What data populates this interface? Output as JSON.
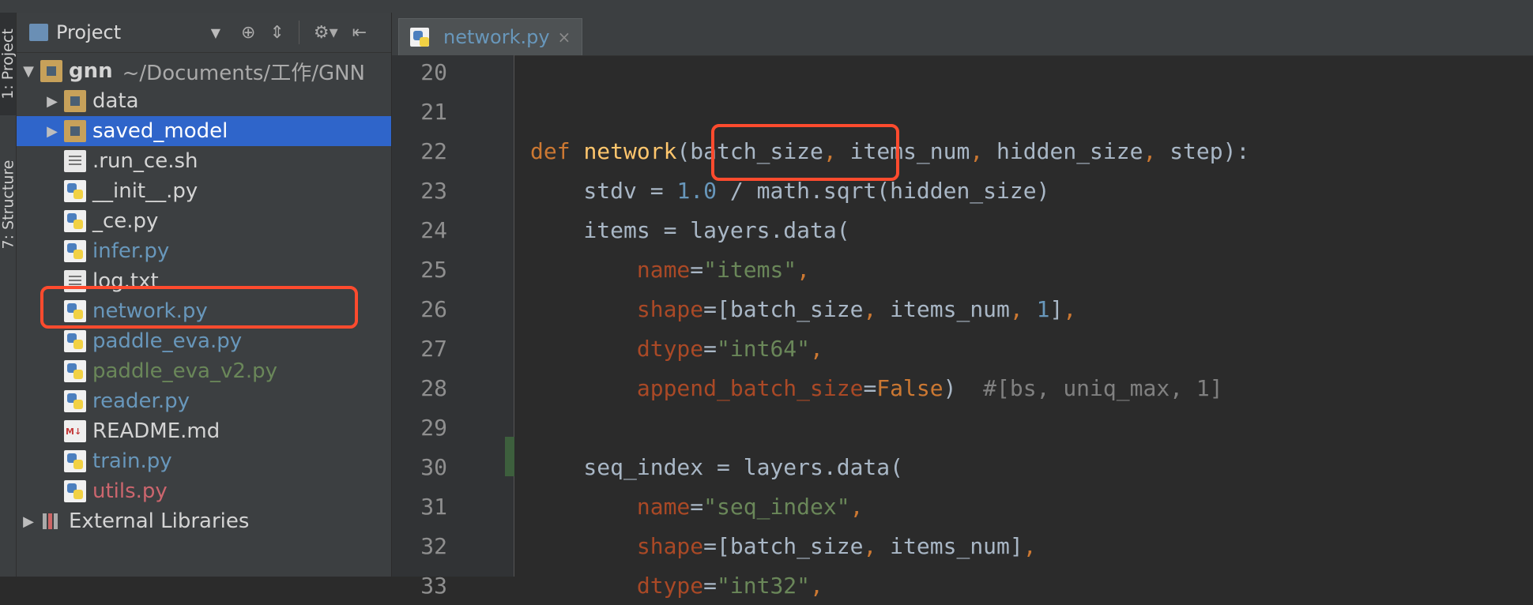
{
  "rail": {
    "project_tab": "1: Project",
    "structure_tab": "7: Structure"
  },
  "project": {
    "title": "Project",
    "tree": [
      {
        "name": "gnn",
        "path": "~/Documents/工作/GNN",
        "icon": "folder",
        "expanded": true,
        "indent": 0
      },
      {
        "name": "data",
        "icon": "folder",
        "collapsed": true,
        "indent": 1
      },
      {
        "name": "saved_model",
        "icon": "folder",
        "collapsed": true,
        "indent": 1,
        "selected": true
      },
      {
        "name": ".run_ce.sh",
        "icon": "txt",
        "indent": 1
      },
      {
        "name": "__init__.py",
        "icon": "py",
        "indent": 1
      },
      {
        "name": "_ce.py",
        "icon": "py",
        "indent": 1
      },
      {
        "name": "infer.py",
        "icon": "py",
        "indent": 1,
        "color": "blue"
      },
      {
        "name": "log.txt",
        "icon": "txt",
        "indent": 1
      },
      {
        "name": "network.py",
        "icon": "py",
        "indent": 1,
        "color": "blue"
      },
      {
        "name": "paddle_eva.py",
        "icon": "py",
        "indent": 1,
        "color": "blue"
      },
      {
        "name": "paddle_eva_v2.py",
        "icon": "py",
        "indent": 1,
        "color": "green"
      },
      {
        "name": "reader.py",
        "icon": "py",
        "indent": 1,
        "color": "blue"
      },
      {
        "name": "README.md",
        "icon": "md",
        "indent": 1
      },
      {
        "name": "train.py",
        "icon": "py",
        "indent": 1,
        "color": "blue"
      },
      {
        "name": "utils.py",
        "icon": "py",
        "indent": 1,
        "color": "red"
      },
      {
        "name": "External Libraries",
        "icon": "lib",
        "collapsed": true,
        "indent": 0
      }
    ]
  },
  "editor": {
    "tab": "network.py",
    "lines": [
      {
        "n": "20",
        "code": ""
      },
      {
        "n": "21",
        "code": ""
      },
      {
        "n": "22",
        "code": "def network(batch_size, items_num, hidden_size, step):"
      },
      {
        "n": "23",
        "code": "    stdv = 1.0 / math.sqrt(hidden_size)"
      },
      {
        "n": "24",
        "code": "    items = layers.data("
      },
      {
        "n": "25",
        "code": "        name=\"items\","
      },
      {
        "n": "26",
        "code": "        shape=[batch_size, items_num, 1],"
      },
      {
        "n": "27",
        "code": "        dtype=\"int64\","
      },
      {
        "n": "28",
        "code": "        append_batch_size=False)  #[bs, uniq_max, 1]"
      },
      {
        "n": "29",
        "code": ""
      },
      {
        "n": "30",
        "code": "    seq_index = layers.data("
      },
      {
        "n": "31",
        "code": "        name=\"seq_index\","
      },
      {
        "n": "32",
        "code": "        shape=[batch_size, items_num],"
      },
      {
        "n": "33",
        "code": "        dtype=\"int32\","
      }
    ]
  }
}
